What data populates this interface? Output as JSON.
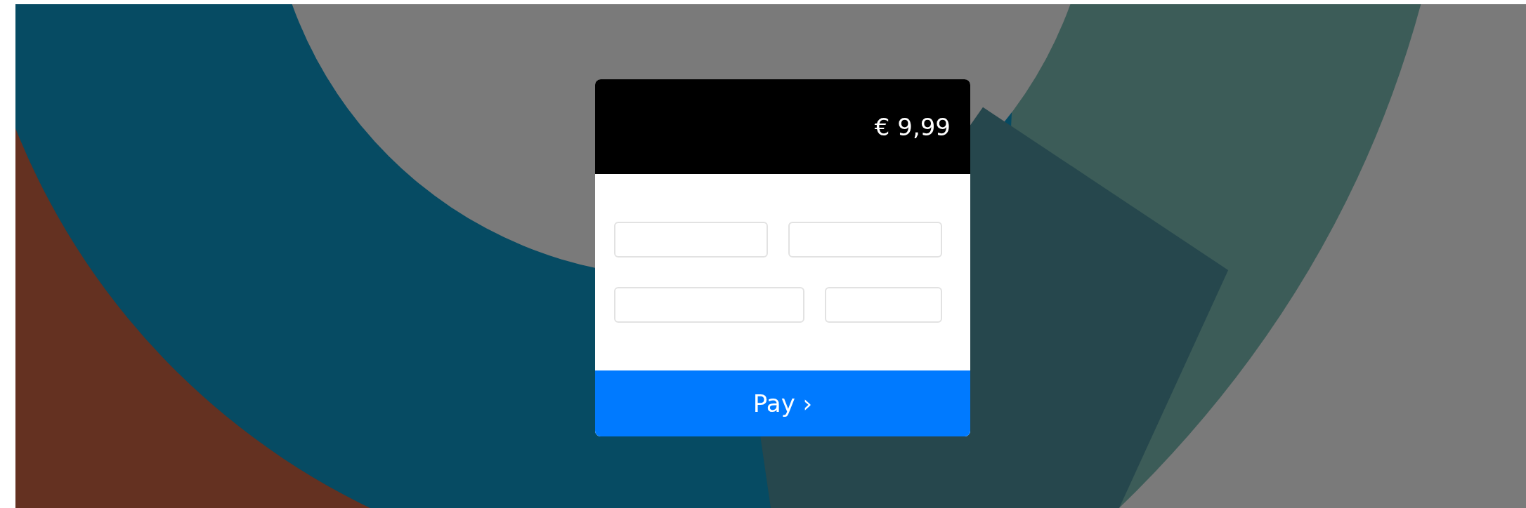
{
  "checkout": {
    "amount": "€ 9,99",
    "field_rows": [
      [
        {
          "kind": "half"
        },
        {
          "kind": "half"
        }
      ],
      [
        {
          "kind": "wide"
        },
        {
          "kind": "narrow"
        }
      ]
    ],
    "pay_button": "Pay ›"
  }
}
